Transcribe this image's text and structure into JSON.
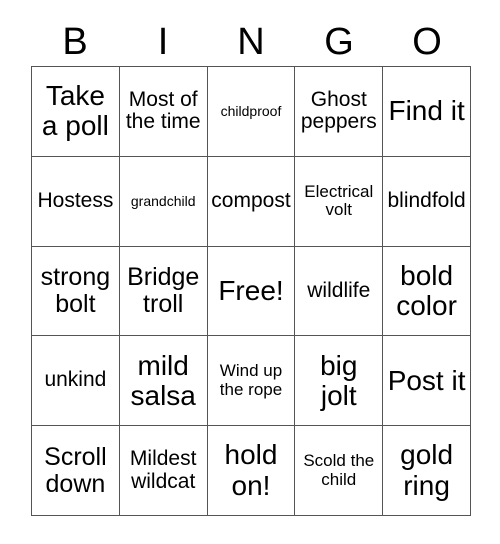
{
  "card": {
    "title": "BINGO",
    "header_letters": [
      "B",
      "I",
      "N",
      "G",
      "O"
    ],
    "columns": 5,
    "rows": 5,
    "free_space_label": "Free!",
    "free_space_position": "N3",
    "grid_line_color": "#555555",
    "text_color": "#000000",
    "background_color": "#ffffff",
    "rows_data": [
      [
        {
          "text": "Take a poll",
          "size": "fs-xl"
        },
        {
          "text": "Most of the time",
          "size": "fs-md"
        },
        {
          "text": "childproof",
          "size": "fs-xs"
        },
        {
          "text": "Ghost peppers",
          "size": "fs-md"
        },
        {
          "text": "Find it",
          "size": "fs-xl"
        }
      ],
      [
        {
          "text": "Hostess",
          "size": "fs-md"
        },
        {
          "text": "grandchild",
          "size": "fs-xs"
        },
        {
          "text": "compost",
          "size": "fs-md"
        },
        {
          "text": "Electrical volt",
          "size": "fs-sm"
        },
        {
          "text": "blindfold",
          "size": "fs-md"
        }
      ],
      [
        {
          "text": "strong bolt",
          "size": "fs-lg"
        },
        {
          "text": "Bridge troll",
          "size": "fs-lg"
        },
        {
          "text": "Free!",
          "size": "fs-xl"
        },
        {
          "text": "wildlife",
          "size": "fs-md"
        },
        {
          "text": "bold color",
          "size": "fs-xl"
        }
      ],
      [
        {
          "text": "unkind",
          "size": "fs-md"
        },
        {
          "text": "mild salsa",
          "size": "fs-xl"
        },
        {
          "text": "Wind up the rope",
          "size": "fs-sm"
        },
        {
          "text": "big jolt",
          "size": "fs-xl"
        },
        {
          "text": "Post it",
          "size": "fs-xl"
        }
      ],
      [
        {
          "text": "Scroll down",
          "size": "fs-lg"
        },
        {
          "text": "Mildest wildcat",
          "size": "fs-md"
        },
        {
          "text": "hold on!",
          "size": "fs-xl"
        },
        {
          "text": "Scold the child",
          "size": "fs-sm"
        },
        {
          "text": "gold ring",
          "size": "fs-xl"
        }
      ]
    ]
  }
}
